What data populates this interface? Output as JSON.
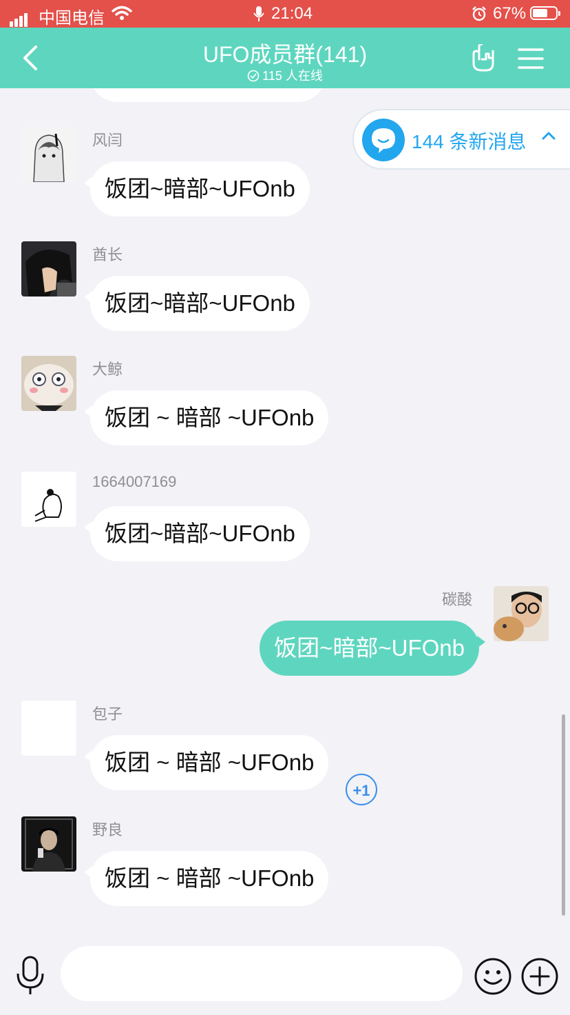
{
  "status_bar": {
    "carrier": "中国电信",
    "time": "21:04",
    "battery_percent": "67%",
    "battery_level": 0.67
  },
  "header": {
    "title": "UFO成员群(141)",
    "subtitle": "115 人在线"
  },
  "new_messages_banner": {
    "text": "144 条新消息"
  },
  "messages": [
    {
      "sender": "风闫",
      "text": "饭团~暗部~UFOnb",
      "direction": "in"
    },
    {
      "sender": "酋长",
      "text": "饭团~暗部~UFOnb",
      "direction": "in"
    },
    {
      "sender": "大鲸",
      "text": "饭团 ~ 暗部 ~UFOnb",
      "direction": "in"
    },
    {
      "sender": "1664007169",
      "text": "饭团~暗部~UFOnb",
      "direction": "in"
    },
    {
      "sender": "碳酸",
      "text": "饭团~暗部~UFOnb",
      "direction": "out"
    },
    {
      "sender": "包子",
      "text": "饭团 ~ 暗部 ~UFOnb",
      "direction": "in"
    },
    {
      "sender": "野良",
      "text": "饭团 ~ 暗部 ~UFOnb",
      "direction": "in"
    }
  ],
  "plus_one_label": "+1",
  "input": {
    "value": "",
    "placeholder": ""
  },
  "colors": {
    "status_bar": "#e4504a",
    "header": "#5ed6bf",
    "outgoing_bubble": "#5ed6bf",
    "accent_blue": "#22a6ee",
    "background": "#f2f2f7"
  },
  "icons": {
    "back": "chevron-left-icon",
    "header_action": "rock-hand-icon",
    "menu": "hamburger-menu-icon",
    "voice": "microphone-icon",
    "emoji": "smiley-icon",
    "more": "plus-circle-icon"
  }
}
